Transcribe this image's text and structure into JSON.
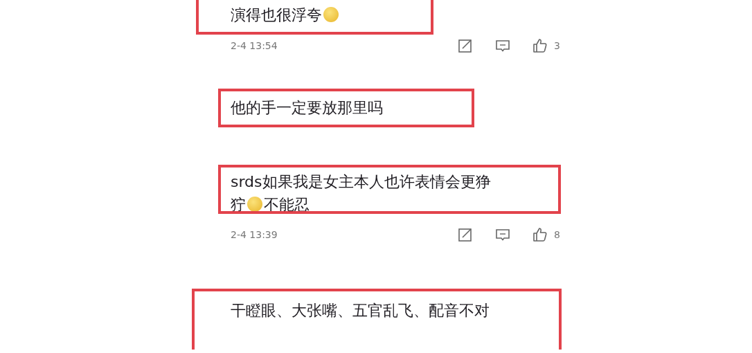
{
  "comments": [
    {
      "segments": [
        {
          "kind": "text",
          "text": "演得也很浮夸"
        },
        {
          "kind": "emoji"
        }
      ],
      "meta": {
        "time": "2-4 13:54",
        "likes": "3"
      }
    },
    {
      "segments": [
        {
          "kind": "text",
          "text": "他的手一定要放那里吗"
        }
      ]
    },
    {
      "segments": [
        {
          "kind": "text",
          "text": "srds如果我是女主本人也许表情会更狰狞"
        },
        {
          "kind": "emoji"
        },
        {
          "kind": "text",
          "text": "不能忍"
        }
      ],
      "meta": {
        "time": "2-4 13:39",
        "likes": "8"
      }
    },
    {
      "segments": [
        {
          "kind": "text",
          "text": "干瞪眼、大张嘴、五官乱飞、配音不对"
        }
      ]
    }
  ]
}
